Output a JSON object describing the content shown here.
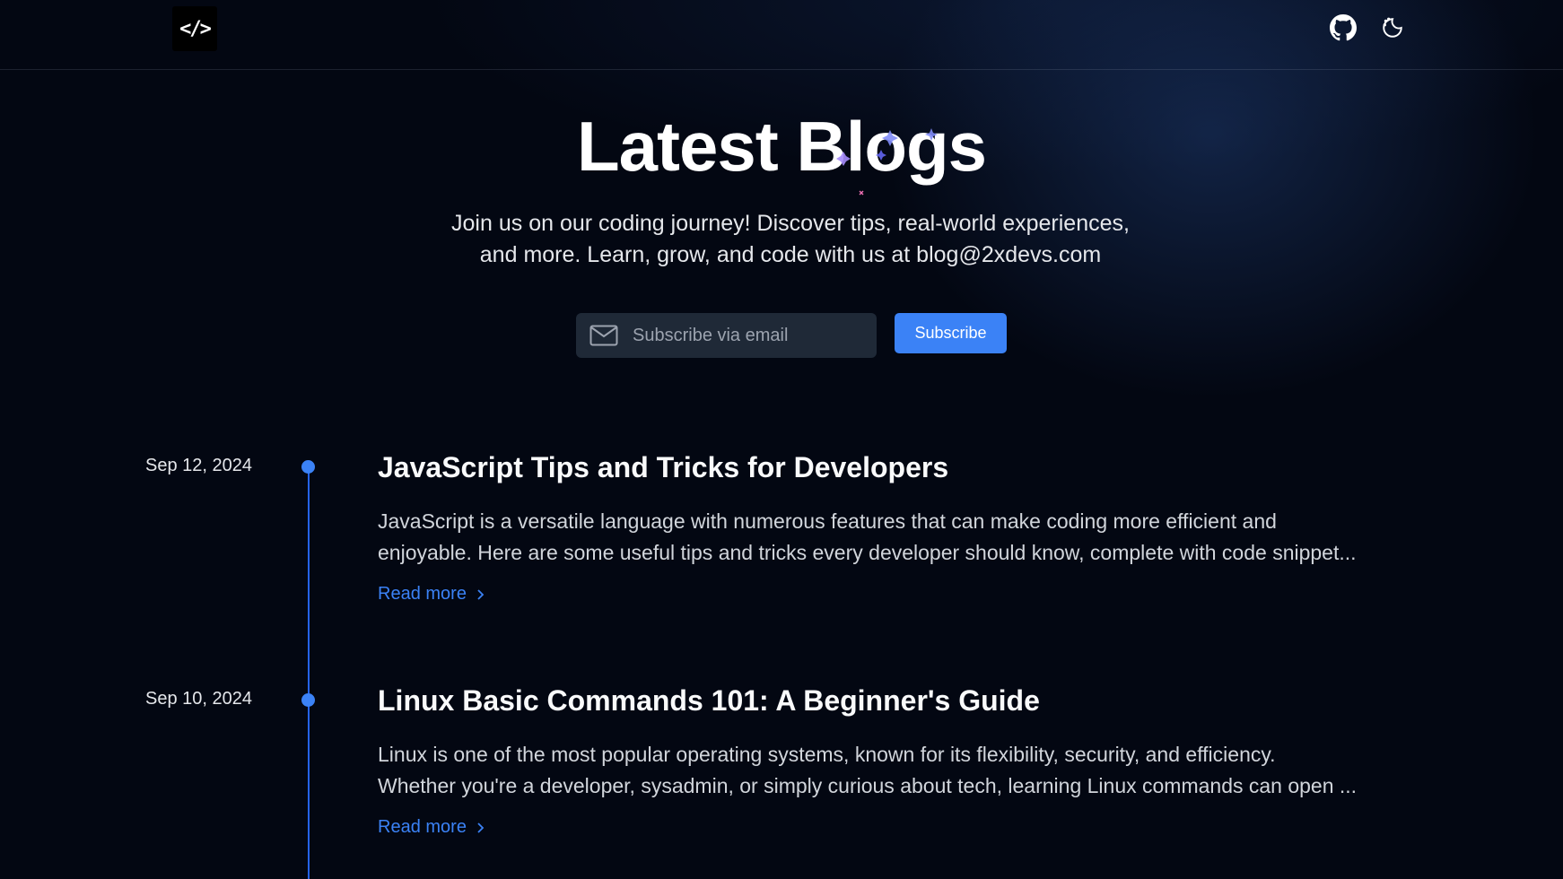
{
  "header": {
    "logo_text": "</>",
    "icons": {
      "github": "github-icon",
      "theme": "theme-toggle-icon"
    }
  },
  "hero": {
    "title": "Latest Blogs",
    "subtitle_line1": "Join us on our coding journey! Discover tips, real-world experiences,",
    "subtitle_line2": "and more. Learn, grow, and code with us at blog@2xdevs.com"
  },
  "subscribe": {
    "placeholder": "Subscribe via email",
    "button_label": "Subscribe",
    "icon": "mail-icon"
  },
  "posts": [
    {
      "date": "Sep 12, 2024",
      "title": "JavaScript Tips and Tricks for Developers",
      "excerpt_line1": "JavaScript is a versatile language with numerous features that can make coding more efficient and",
      "excerpt_line2": "enjoyable. Here are some useful tips and tricks every developer should know, complete with code snippet...",
      "read_more": "Read more"
    },
    {
      "date": "Sep 10, 2024",
      "title": "Linux Basic Commands 101: A Beginner's Guide",
      "excerpt_line1": "Linux is one of the most popular operating systems, known for its flexibility, security, and efficiency.",
      "excerpt_line2": "Whether you're a developer, sysadmin, or simply curious about tech, learning Linux commands can open ...",
      "read_more": "Read more"
    }
  ],
  "colors": {
    "background": "#030712",
    "accent": "#3b82f6",
    "timeline": "#2563eb"
  }
}
